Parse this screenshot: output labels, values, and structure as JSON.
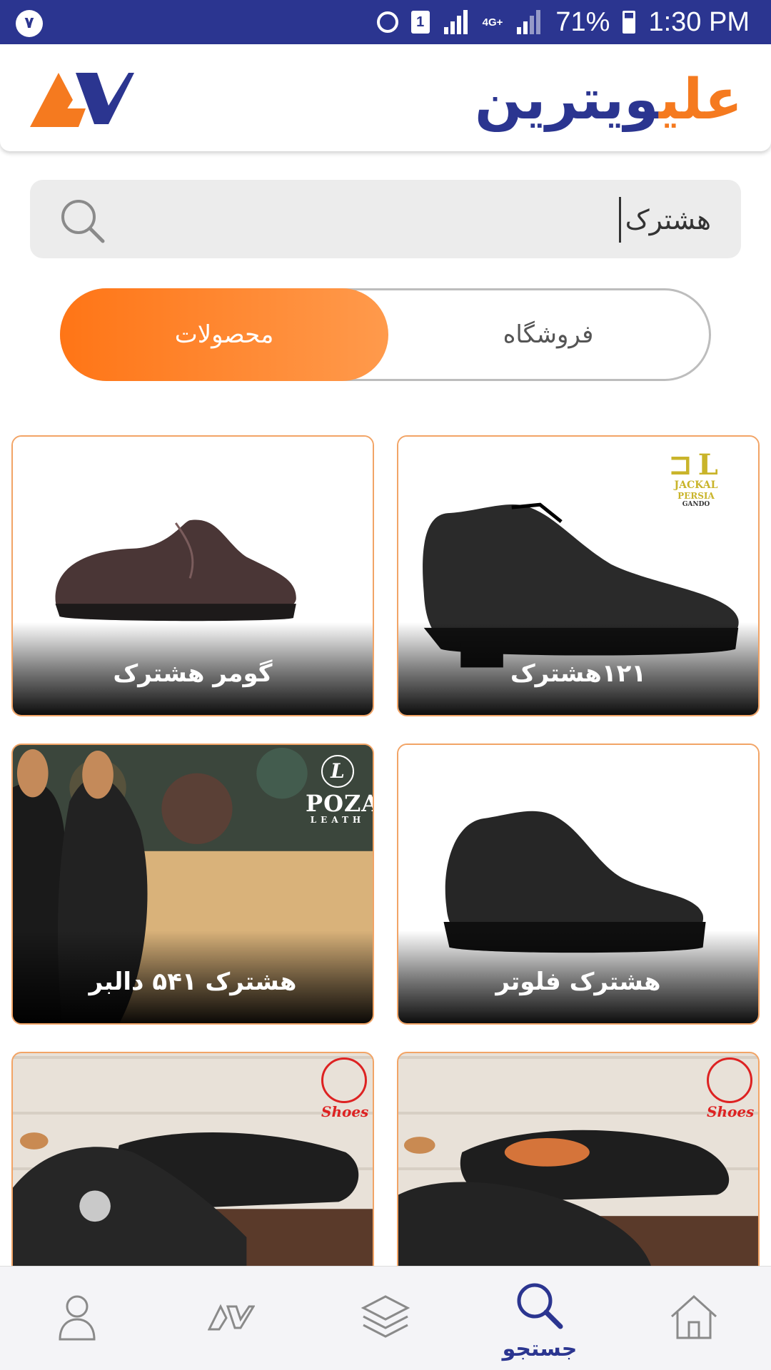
{
  "status_bar": {
    "notification_count": "۷",
    "sim_slot": "1",
    "network": "4G+",
    "battery": "71%",
    "time": "1:30 PM"
  },
  "header": {
    "brand_part1": "علی",
    "brand_part2": "ویترین"
  },
  "search": {
    "value": "هشترک"
  },
  "toggle": {
    "active_label": "محصولات",
    "inactive_label": "فروشگاه"
  },
  "products": [
    {
      "title": "گومر هشترک"
    },
    {
      "title": "۱۲۱هشترک",
      "brand_logo_text": [
        "JACKAL",
        "PERSIA",
        "GANDO"
      ]
    },
    {
      "title": "هشترک ۵۴۱ دالبر",
      "brand_logo_text": [
        "POZA",
        "LEATH"
      ]
    },
    {
      "title": "هشترک فلوتر"
    },
    {
      "title": "",
      "brand_logo_text": [
        "Shoes"
      ]
    },
    {
      "title": "",
      "brand_logo_text": [
        "Shoes"
      ]
    }
  ],
  "bottom_nav": {
    "active_label": "جستجو",
    "items": [
      "profile-icon",
      "brand-icon",
      "layers-icon",
      "search-icon",
      "home-icon"
    ]
  },
  "colors": {
    "primary": "#2b3590",
    "accent": "#f57a1f"
  }
}
